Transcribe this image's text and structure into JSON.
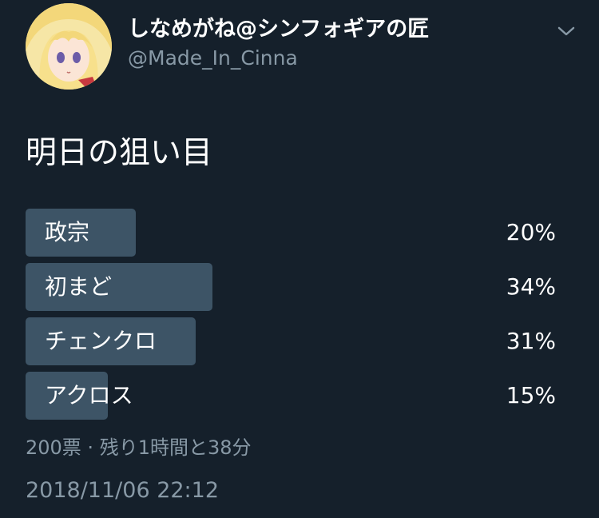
{
  "author": {
    "display_name": "しなめがね@シンフォギアの匠",
    "handle": "@Made_In_Cinna",
    "avatar_icon": "anime-avatar-icon"
  },
  "menu_icon": "chevron-down-icon",
  "tweet": {
    "text": "明日の狙い目"
  },
  "poll": {
    "options": [
      {
        "label": "政宗",
        "percent_text": "20%",
        "percent": 20
      },
      {
        "label": "初まど",
        "percent_text": "34%",
        "percent": 34
      },
      {
        "label": "チェンクロ",
        "percent_text": "31%",
        "percent": 31
      },
      {
        "label": "アクロス",
        "percent_text": "15%",
        "percent": 15
      }
    ],
    "votes_and_time": "200票 · 残り1時間と38分"
  },
  "timestamp": "2018/11/06 22:12",
  "colors": {
    "background": "#15202b",
    "bar": "#3d5466",
    "secondary_text": "#8899a6"
  }
}
